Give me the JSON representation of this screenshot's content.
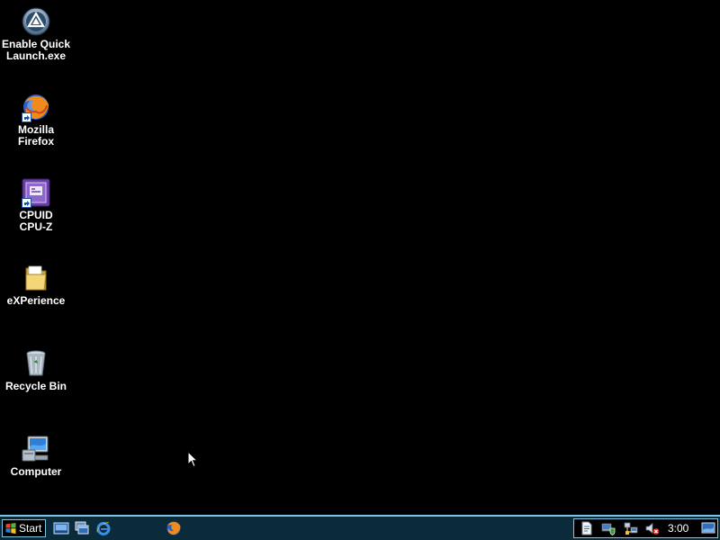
{
  "desktop": {
    "background_color": "#000000",
    "icons": [
      {
        "label": "Enable Quick\nLaunch.exe",
        "icon": "aqua-app-icon"
      },
      {
        "label": "Mozilla\nFirefox",
        "icon": "firefox-icon"
      },
      {
        "label": "CPUID\nCPU-Z",
        "icon": "cpuz-icon"
      },
      {
        "label": "eXPerience",
        "icon": "folder-icon"
      },
      {
        "label": "Recycle Bin",
        "icon": "recycle-bin-icon"
      },
      {
        "label": "Computer",
        "icon": "computer-icon"
      }
    ]
  },
  "taskbar": {
    "accent_color": "#7fc6e6",
    "start_label": "Start",
    "quick_launch": [
      {
        "icon": "show-desktop-icon"
      },
      {
        "icon": "switch-windows-icon"
      },
      {
        "icon": "internet-explorer-icon"
      },
      {
        "icon": "firefox-icon"
      }
    ],
    "tray": {
      "icons": [
        {
          "icon": "document-icon"
        },
        {
          "icon": "security-shield-icon"
        },
        {
          "icon": "network-icon"
        },
        {
          "icon": "volume-muted-icon"
        },
        {
          "icon": "desktop-icon"
        }
      ],
      "clock": "3:00"
    }
  }
}
